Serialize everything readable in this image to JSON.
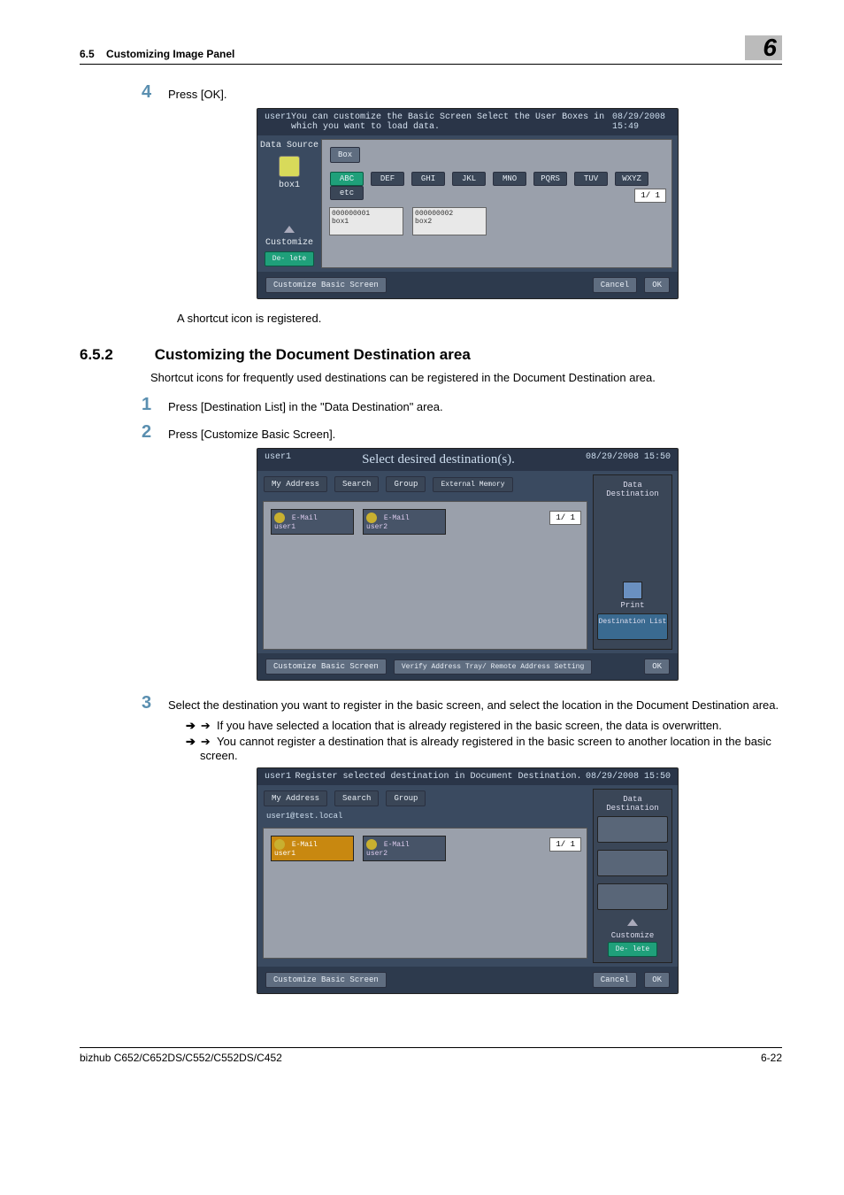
{
  "header": {
    "section": "6.5",
    "title": "Customizing Image Panel",
    "chapter": "6"
  },
  "step4": {
    "num": "4",
    "text": "Press [OK]."
  },
  "panel1": {
    "user": "user1",
    "msg": "You can customize the Basic Screen Select the User Boxes in which you want to load data.",
    "datetime": "08/29/2008 15:49",
    "left_title": "Data Source",
    "left_box_label": "box1",
    "box_button": "Box",
    "tabs": [
      "ABC",
      "DEF",
      "GHI",
      "JKL",
      "MNO",
      "PQRS",
      "TUV",
      "WXYZ",
      "etc"
    ],
    "boxes": [
      {
        "id": "000000001",
        "name": "box1"
      },
      {
        "id": "000000002",
        "name": "box2"
      }
    ],
    "pager": "1/ 1",
    "customize": "Customize",
    "delete": "De-\nlete",
    "footer_label": "Customize Basic Screen",
    "cancel": "Cancel",
    "ok": "OK"
  },
  "after_step4": "A shortcut icon is registered.",
  "section652": {
    "num": "6.5.2",
    "title": "Customizing the Document Destination area",
    "intro": "Shortcut icons for frequently used destinations can be registered in the Document Destination area."
  },
  "step1": {
    "num": "1",
    "text": "Press [Destination List] in the \"Data Destination\" area."
  },
  "step2": {
    "num": "2",
    "text": "Press [Customize Basic Screen]."
  },
  "panel2": {
    "user": "user1",
    "title": "Select desired destination(s).",
    "datetime": "08/29/2008 15:50",
    "tabs": [
      "My Address",
      "Search",
      "Group",
      "External Memory"
    ],
    "right_title": "Data Destination",
    "items": [
      {
        "type": "E-Mail",
        "name": "user1"
      },
      {
        "type": "E-Mail",
        "name": "user2"
      }
    ],
    "pager": "1/ 1",
    "print": "Print",
    "destlist": "Destination List",
    "footer_label": "Customize Basic Screen",
    "verify": "Verify Address Tray/\nRemote Address Setting",
    "ok": "OK"
  },
  "step3": {
    "num": "3",
    "text": "Select the destination you want to register in the basic screen, and select the location in the Document Destination area.",
    "bullet1": "If you have selected a location that is already registered in the basic screen, the data is overwritten.",
    "bullet2": "You cannot register a destination that is already registered in the basic screen to another location in the basic screen."
  },
  "panel3": {
    "user": "user1",
    "msg": "Register selected destination in Document Destination.",
    "datetime": "08/29/2008 15:50",
    "tabs": [
      "My Address",
      "Search",
      "Group"
    ],
    "subinfo": "user1@test.local",
    "right_title": "Data Destination",
    "items": [
      {
        "type": "E-Mail",
        "name": "user1"
      },
      {
        "type": "E-Mail",
        "name": "user2"
      }
    ],
    "pager": "1/ 1",
    "customize": "Customize",
    "delete": "De-\nlete",
    "footer_label": "Customize Basic Screen",
    "cancel": "Cancel",
    "ok": "OK"
  },
  "footer": {
    "model": "bizhub C652/C652DS/C552/C552DS/C452",
    "page": "6-22"
  }
}
